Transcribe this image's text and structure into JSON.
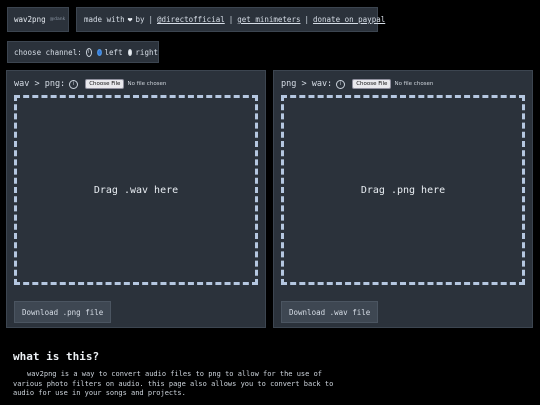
{
  "app": {
    "name": "wav2png",
    "tag": "@dank"
  },
  "credits": {
    "made_with": "made with",
    "by": "by",
    "author": "@directofficial",
    "link_minimeters": "get minimeters",
    "link_donate": "donate on paypal"
  },
  "channel": {
    "label": "choose channel:",
    "info": "i",
    "left": "left",
    "right": "right",
    "selected": "left"
  },
  "converters": [
    {
      "heading": "wav > png:",
      "info": "i",
      "file_button": "Choose File",
      "file_status": "No file chosen",
      "drop_text": "Drag .wav here",
      "download": "Download .png file"
    },
    {
      "heading": "png > wav:",
      "info": "i",
      "file_button": "Choose File",
      "file_status": "No file chosen",
      "drop_text": "Drag .png here",
      "download": "Download .wav file"
    }
  ],
  "about": {
    "title": "what is this?",
    "body": "wav2png is a way to convert audio files to png to allow for the use of various photo filters on audio. this page also allows you to convert back to audio for use in your songs and projects."
  }
}
